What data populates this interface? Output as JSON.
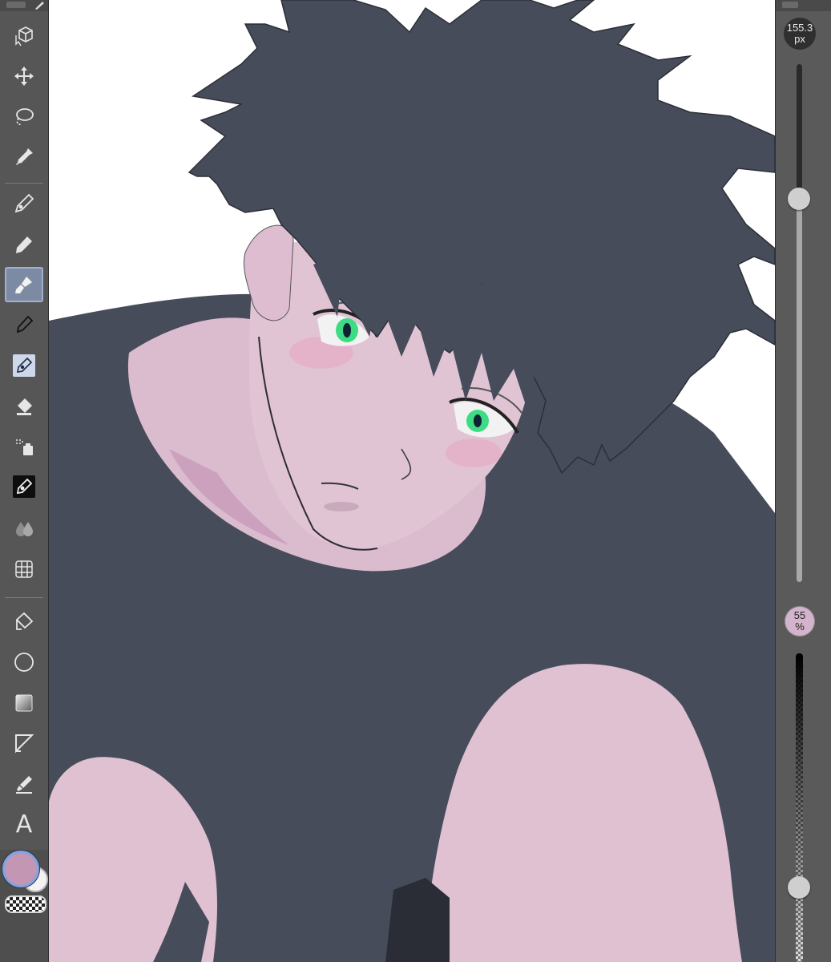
{
  "toolbar": {
    "tools": [
      {
        "name": "operation-tool",
        "icon": "cube-cursor-icon"
      },
      {
        "name": "move-tool",
        "icon": "move-arrows-icon"
      },
      {
        "name": "selection-tool",
        "icon": "lasso-icon"
      },
      {
        "name": "eyedropper-tool",
        "icon": "eyedropper-icon"
      },
      {
        "name": "pen-tool",
        "icon": "pen-nib-icon"
      },
      {
        "name": "pencil-tool",
        "icon": "pencil-icon"
      },
      {
        "name": "brush-tool",
        "icon": "paint-brush-icon",
        "selected": true
      },
      {
        "name": "airbrush-tool",
        "icon": "fine-pen-icon"
      },
      {
        "name": "decoration-tool",
        "icon": "calligraphy-pen-icon"
      },
      {
        "name": "eraser-tool",
        "icon": "eraser-icon"
      },
      {
        "name": "spray-tool",
        "icon": "spray-icon"
      },
      {
        "name": "vector-pen-tool",
        "icon": "vector-pen-icon"
      },
      {
        "name": "blend-tool",
        "icon": "water-drops-icon"
      },
      {
        "name": "perspective-ruler-tool",
        "icon": "grid-ruler-icon"
      },
      {
        "name": "fill-tool",
        "icon": "paint-bucket-icon"
      },
      {
        "name": "figure-tool",
        "icon": "circle-shape-icon"
      },
      {
        "name": "gradient-tool",
        "icon": "gradient-square-icon"
      },
      {
        "name": "frame-tool",
        "icon": "frame-border-icon"
      },
      {
        "name": "correct-line-tool",
        "icon": "line-correction-icon"
      },
      {
        "name": "text-tool",
        "icon": "text-a-icon",
        "label": "A"
      }
    ],
    "colors": {
      "main": "#c397b4",
      "sub": "#f3f3f3",
      "accent": "#7fa3e6"
    }
  },
  "brush_size": {
    "value": "155.3",
    "unit": "px",
    "level": 0.26
  },
  "brush_opacity": {
    "value": "55",
    "unit": "%",
    "level": 0.55
  },
  "canvas": {
    "colors": {
      "hair": "#474c5a",
      "shirt": "#474c5a",
      "skin": "#e0c2d3",
      "eyes": "#3ddc84",
      "background": "#ffffff"
    }
  }
}
